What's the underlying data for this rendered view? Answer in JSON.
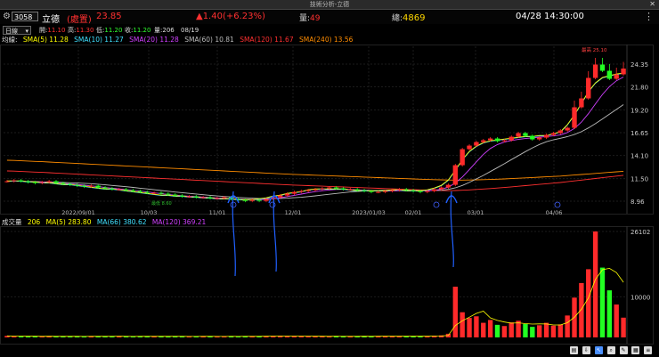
{
  "window": {
    "title": "技術分析-立德",
    "close_icon": "close-icon"
  },
  "header": {
    "code": "3058",
    "name": "立德",
    "status": "(處置)",
    "price": "23.85",
    "change": "▲1.40(+6.23%)",
    "volume_label": "量:",
    "volume": "49",
    "total_label": "總:",
    "total": "4869",
    "datetime": "04/28 14:30:00"
  },
  "ohlc": {
    "period": "日線",
    "open_label": "開:",
    "open": "11.10",
    "high_label": "高:",
    "high": "11.30",
    "low_label": "低:",
    "low": "11.20",
    "close_label": "收:",
    "close": "11.20",
    "volume": "206",
    "date": "08/19"
  },
  "ma_legend": {
    "prefix": "均線:",
    "items": [
      {
        "label": "SMA(5) 11.28",
        "color": "#ffff00"
      },
      {
        "label": "SMA(10) 11.27",
        "color": "#40e0ff"
      },
      {
        "label": "SMA(20) 11.28",
        "color": "#d040ff"
      },
      {
        "label": "SMA(60) 10.81",
        "color": "#bbbbbb"
      },
      {
        "label": "SMA(120) 11.67",
        "color": "#ff3030"
      },
      {
        "label": "SMA(240) 13.56",
        "color": "#ff8c00"
      }
    ]
  },
  "vol_legend": {
    "prefix": "成交量",
    "value": "206",
    "items": [
      {
        "label": "MA(5) 283.80",
        "color": "#ffff00"
      },
      {
        "label": "MA(66) 380.62",
        "color": "#40e0ff"
      },
      {
        "label": "MA(120) 369.21",
        "color": "#d040ff"
      }
    ]
  },
  "chart_data": [
    {
      "type": "candlestick",
      "title": "",
      "y_ticks": [
        "24.35",
        "21.80",
        "19.20",
        "16.65",
        "14.10",
        "11.50",
        "8.96"
      ],
      "ylim": [
        8.96,
        24.35
      ],
      "x_ticks": [
        "2022/09/01",
        "10/03",
        "11/01",
        "12/01",
        "2023/01/03",
        "02/01",
        "03/01",
        "04/06"
      ],
      "peak_label": "最高 25.10",
      "low_label": "最低 8.60",
      "close_series": [
        11.2,
        11.3,
        11.2,
        11.1,
        11.0,
        11.1,
        11.2,
        11.0,
        10.9,
        10.8,
        10.7,
        10.6,
        10.7,
        10.5,
        10.4,
        10.3,
        10.3,
        10.2,
        10.1,
        10.0,
        9.9,
        9.9,
        9.8,
        9.7,
        9.6,
        9.5,
        9.5,
        9.4,
        9.4,
        9.3,
        9.3,
        9.4,
        9.2,
        9.1,
        9.0,
        9.1,
        9.0,
        9.2,
        9.4,
        9.6,
        9.8,
        10.0,
        10.1,
        10.2,
        10.3,
        10.4,
        10.5,
        10.4,
        10.3,
        10.3,
        10.2,
        10.1,
        10.0,
        10.0,
        10.1,
        10.2,
        10.3,
        10.2,
        10.1,
        10.0,
        10.1,
        10.3,
        10.5,
        10.8,
        13.0,
        14.8,
        15.2,
        15.6,
        15.8,
        16.0,
        15.7,
        15.8,
        16.2,
        16.6,
        16.3,
        15.9,
        16.1,
        16.4,
        16.6,
        16.9,
        17.2,
        19.5,
        20.5,
        22.8,
        24.3,
        23.6,
        22.7,
        23.2,
        23.85
      ],
      "sma5": [
        11.2,
        11.2,
        11.2,
        11.1,
        11.1,
        11.0,
        11.0,
        10.9,
        10.8,
        10.8,
        10.7,
        10.6,
        10.5,
        10.4,
        10.3,
        10.3,
        10.2,
        10.1,
        10.0,
        9.9,
        9.8,
        9.7,
        9.6,
        9.6,
        9.5,
        9.5,
        9.4,
        9.4,
        9.3,
        9.3,
        9.2,
        9.2,
        9.2,
        9.1,
        9.1,
        9.1,
        9.2,
        9.3,
        9.5,
        9.6,
        9.8,
        9.9,
        10.0,
        10.2,
        10.3,
        10.3,
        10.3,
        10.3,
        10.3,
        10.2,
        10.1,
        10.1,
        10.1,
        10.1,
        10.1,
        10.2,
        10.2,
        10.1,
        10.1,
        10.1,
        10.2,
        10.4,
        10.7,
        11.3,
        12.4,
        13.6,
        14.5,
        15.1,
        15.5,
        15.7,
        15.8,
        15.9,
        16.0,
        16.1,
        16.2,
        16.2,
        16.3,
        16.3,
        16.5,
        16.7,
        17.5,
        18.6,
        19.9,
        21.2,
        22.2,
        22.8,
        23.0,
        23.2,
        23.3
      ],
      "sma240": [
        13.56,
        13.54,
        13.5,
        13.47,
        13.43,
        13.4,
        13.36,
        13.32,
        13.28,
        13.24,
        13.2,
        13.16,
        13.12,
        13.08,
        13.04,
        13.0,
        12.96,
        12.92,
        12.88,
        12.84,
        12.8,
        12.76,
        12.72,
        12.68,
        12.64,
        12.6,
        12.56,
        12.52,
        12.48,
        12.44,
        12.4,
        12.36,
        12.32,
        12.28,
        12.24,
        12.2,
        12.16,
        12.12,
        12.08,
        12.04,
        12.0,
        11.97,
        11.94,
        11.91,
        11.88,
        11.85,
        11.82,
        11.79,
        11.76,
        11.73,
        11.7,
        11.67,
        11.64,
        11.61,
        11.58,
        11.55,
        11.52,
        11.49,
        11.46,
        11.43,
        11.4,
        11.38,
        11.36,
        11.34,
        11.33,
        11.33,
        11.34,
        11.36,
        11.38,
        11.4,
        11.43,
        11.46,
        11.5,
        11.54,
        11.58,
        11.62,
        11.66,
        11.7,
        11.74,
        11.78,
        11.84,
        11.9,
        11.96,
        12.02,
        12.08,
        12.14,
        12.2,
        12.26,
        12.32
      ]
    },
    {
      "type": "bar",
      "title": "",
      "y_ticks": [
        "26102",
        "10000"
      ],
      "ylim": [
        0,
        26102
      ],
      "values": [
        380,
        250,
        300,
        210,
        260,
        330,
        280,
        240,
        220,
        300,
        260,
        210,
        320,
        280,
        230,
        260,
        300,
        240,
        220,
        260,
        310,
        280,
        240,
        200,
        260,
        300,
        250,
        220,
        280,
        240,
        210,
        300,
        270,
        240,
        260,
        300,
        280,
        330,
        360,
        410,
        300,
        280,
        260,
        320,
        280,
        240,
        260,
        300,
        270,
        240,
        300,
        280,
        260,
        320,
        300,
        280,
        260,
        300,
        280,
        320,
        300,
        400,
        500,
        900,
        12500,
        6200,
        4800,
        5200,
        3600,
        4300,
        3100,
        2800,
        3700,
        4100,
        3300,
        2600,
        3000,
        3600,
        2900,
        3200,
        5400,
        9800,
        13400,
        16800,
        26102,
        17200,
        11600,
        8100,
        4869
      ]
    }
  ]
}
